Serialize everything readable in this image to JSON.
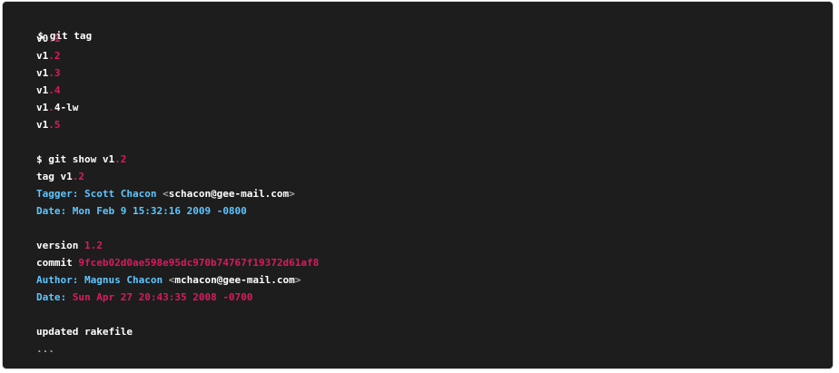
{
  "terminal": {
    "cmd_tag": {
      "prompt": "$ git tag"
    },
    "tags": [
      {
        "a": "v0",
        "dot": ".",
        "b": "1"
      },
      {
        "a": "v1",
        "dot": ".",
        "b": "2"
      },
      {
        "a": "v1",
        "dot": ".",
        "b": "3"
      },
      {
        "a": "v1",
        "dot": ".",
        "b": "4"
      },
      {
        "a": "v1",
        "dot": ".",
        "b": "4-lw"
      },
      {
        "a": "v1",
        "dot": ".",
        "b": "5"
      }
    ],
    "cmd_show": {
      "prefix": "$ git show v1",
      "dot": ".",
      "ver": "2"
    },
    "tag_line": {
      "prefix": "tag v1",
      "dot": ".",
      "ver": "2"
    },
    "tagger": {
      "label": "Tagger: Scott Chacon ",
      "lt": "<",
      "email": "schacon@gee-mail.com",
      "gt": ">"
    },
    "date1": {
      "label": "Date: ",
      "value": "Mon Feb 9 15:32:16 2009 -0800"
    },
    "version": {
      "label": "version ",
      "value": "1.2"
    },
    "commit": {
      "label": "commit ",
      "hash": "9fceb02d0ae598e95dc970b74767f19372d61af8"
    },
    "author": {
      "label": "Author: Magnus Chacon ",
      "lt": "<",
      "email": "mchacon@gee-mail.com",
      "gt": ">"
    },
    "date2": {
      "label": "Date: ",
      "value": "Sun Apr 27 20:43:35 2008 -0700"
    },
    "message": "updated rakefile",
    "ellipsis": "..."
  }
}
